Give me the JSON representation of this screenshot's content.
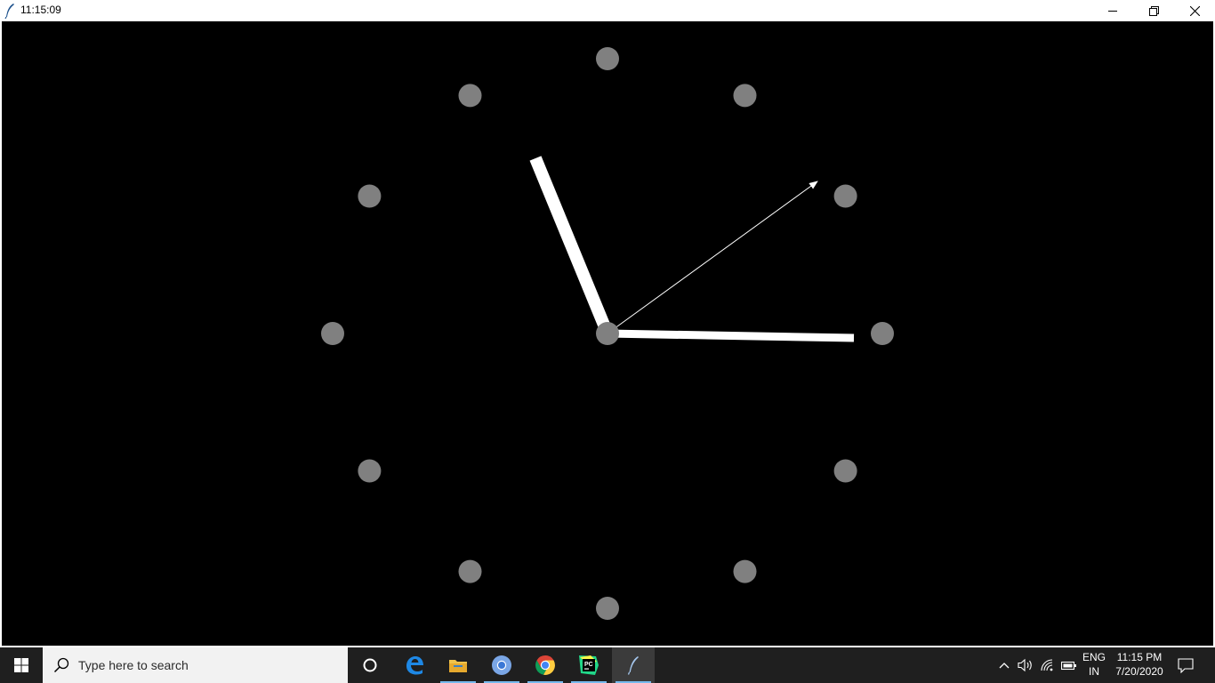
{
  "window": {
    "title": "11:15:09",
    "controls": {
      "minimize_icon": "minimize-icon",
      "maximize_icon": "restore-icon",
      "close_icon": "close-icon"
    }
  },
  "clock": {
    "background": "#000000",
    "hour_marker_color": "#808080",
    "hand_color": "#ffffff",
    "time_shown": "11:15:09"
  },
  "taskbar": {
    "search_placeholder": "Type here to search",
    "apps": [
      {
        "name": "cortana",
        "icon": "cortana-icon"
      },
      {
        "name": "edge",
        "icon": "edge-icon"
      },
      {
        "name": "file-explorer",
        "icon": "folder-icon"
      },
      {
        "name": "chromium",
        "icon": "chromium-icon"
      },
      {
        "name": "chrome",
        "icon": "chrome-icon"
      },
      {
        "name": "pycharm",
        "icon": "pycharm-icon"
      },
      {
        "name": "tk-app",
        "icon": "feather-icon"
      }
    ],
    "tray": {
      "language_top": "ENG",
      "language_bottom": "IN",
      "time": "11:15 PM",
      "date": "7/20/2020"
    }
  }
}
